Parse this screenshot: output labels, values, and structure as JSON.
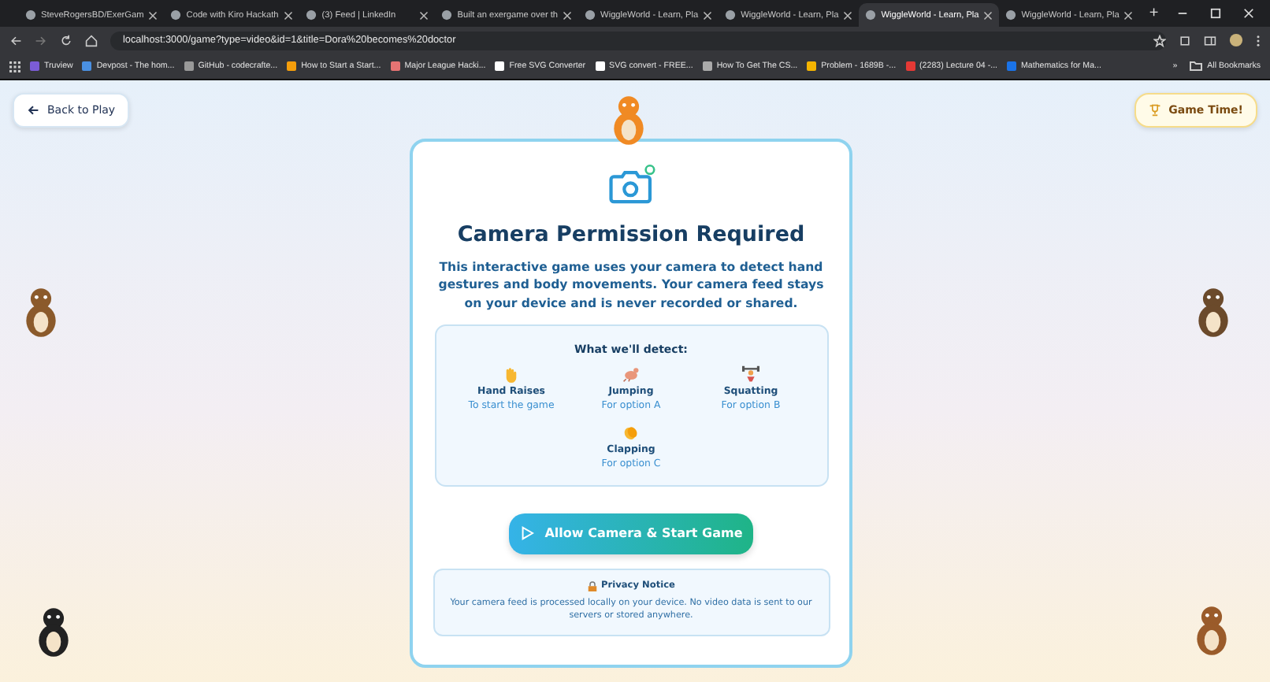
{
  "browser": {
    "tabs": [
      {
        "title": "SteveRogersBD/ExerGam",
        "selected": false
      },
      {
        "title": "Code with Kiro Hackath",
        "selected": false
      },
      {
        "title": "(3) Feed | LinkedIn",
        "selected": false
      },
      {
        "title": "Built an exergame over th",
        "selected": false
      },
      {
        "title": "WiggleWorld - Learn, Pla",
        "selected": false
      },
      {
        "title": "WiggleWorld - Learn, Pla",
        "selected": false
      },
      {
        "title": "WiggleWorld - Learn, Pla",
        "selected": true
      },
      {
        "title": "WiggleWorld - Learn, Pla",
        "selected": false
      }
    ],
    "new_tab": "+",
    "address": "localhost:3000/game?type=video&id=1&title=Dora%20becomes%20doctor",
    "bookmarks": [
      "Truview",
      "Devpost - The hom...",
      "GitHub - codecrafte...",
      "How to Start a Start...",
      "Major League Hacki...",
      "Free SVG Converter",
      "SVG convert - FREE...",
      "How To Get The CS...",
      "Problem - 1689B -...",
      "(2283) Lecture 04 -...",
      "Mathematics for Ma..."
    ],
    "bookmarks_more": "»",
    "all_bookmarks": "All Bookmarks"
  },
  "page": {
    "back_button": "Back to Play",
    "game_time_badge": "Game Time!",
    "card": {
      "title": "Camera Permission Required",
      "description": "This interactive game uses your camera to detect hand gestures and body movements. Your camera feed stays on your device and is never recorded or shared.",
      "detect_title": "What we'll detect:",
      "detections": [
        {
          "name": "Hand Raises",
          "purpose": "To start the game"
        },
        {
          "name": "Jumping",
          "purpose": "For option A"
        },
        {
          "name": "Squatting",
          "purpose": "For option B"
        },
        {
          "name": "Clapping",
          "purpose": "For option C"
        }
      ],
      "start_button": "Allow Camera & Start Game",
      "privacy_title": "Privacy Notice",
      "privacy_text": "Your camera feed is processed locally on your device. No video data is sent to our servers or stored anywhere."
    }
  }
}
